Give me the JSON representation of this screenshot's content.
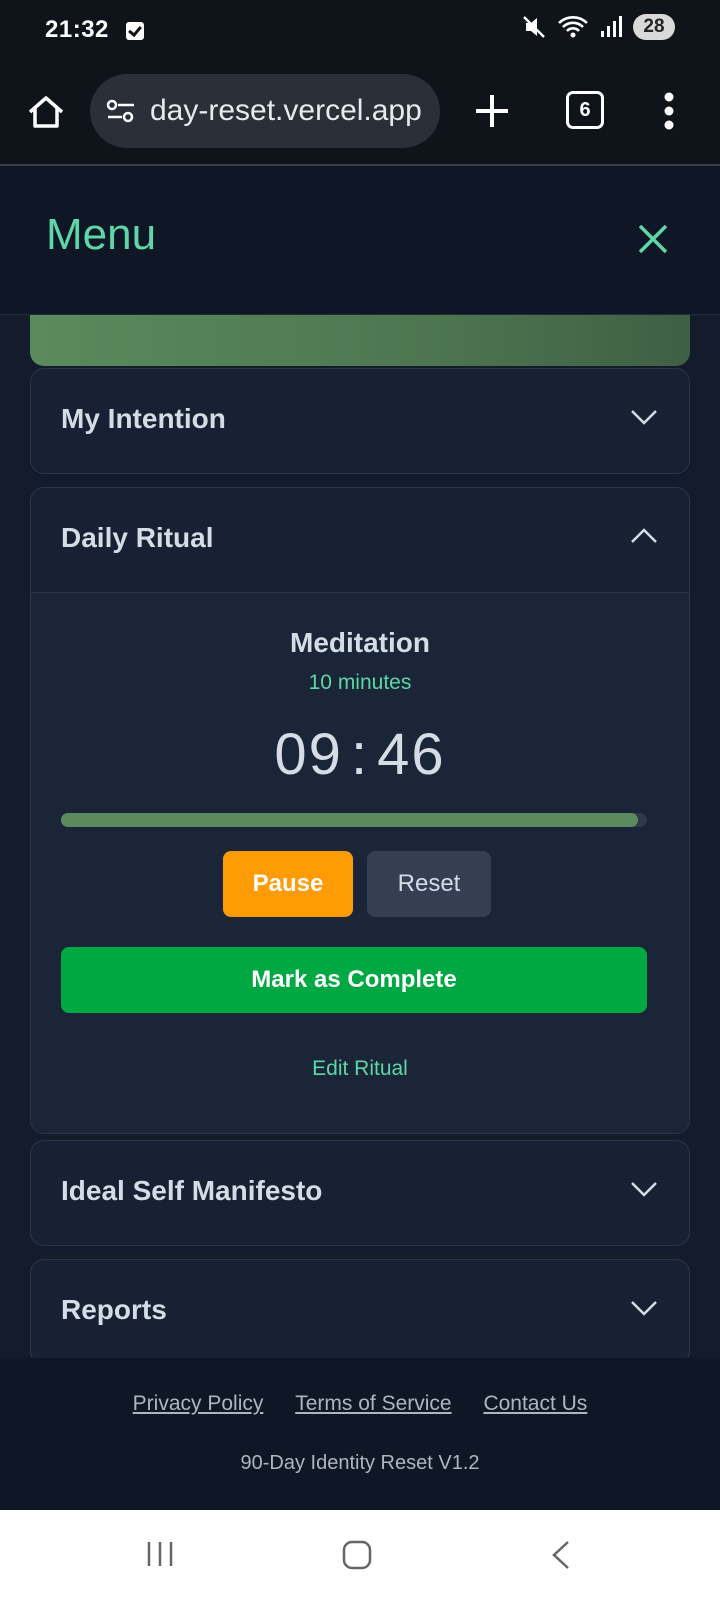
{
  "status_bar": {
    "time": "21:32",
    "battery": "28",
    "icons": [
      "check-notification-icon",
      "mute-icon",
      "wifi-icon",
      "signal-icon"
    ]
  },
  "browser": {
    "url": "day-reset.vercel.app",
    "tab_count": "6"
  },
  "header": {
    "title": "Menu",
    "accent_color": "#5ed6a6"
  },
  "sections": {
    "intention": {
      "label": "My Intention",
      "expanded": false
    },
    "ritual": {
      "label": "Daily Ritual",
      "expanded": true
    },
    "manifesto": {
      "label": "Ideal Self Manifesto",
      "expanded": false
    },
    "reports": {
      "label": "Reports",
      "expanded": false
    }
  },
  "ritual": {
    "name": "Meditation",
    "duration": "10 minutes",
    "timer_minutes": "09",
    "timer_sep": ":",
    "timer_seconds": "46",
    "progress": 0.984,
    "pause_label": "Pause",
    "reset_label": "Reset",
    "complete_label": "Mark as Complete",
    "edit_label": "Edit Ritual"
  },
  "footer": {
    "links": [
      "Privacy Policy",
      "Terms of Service",
      "Contact Us"
    ],
    "version": "90-Day Identity Reset V1.2"
  },
  "colors": {
    "pause": "#ff9b05",
    "complete": "#00a843",
    "progress": "#5b8a5e"
  }
}
